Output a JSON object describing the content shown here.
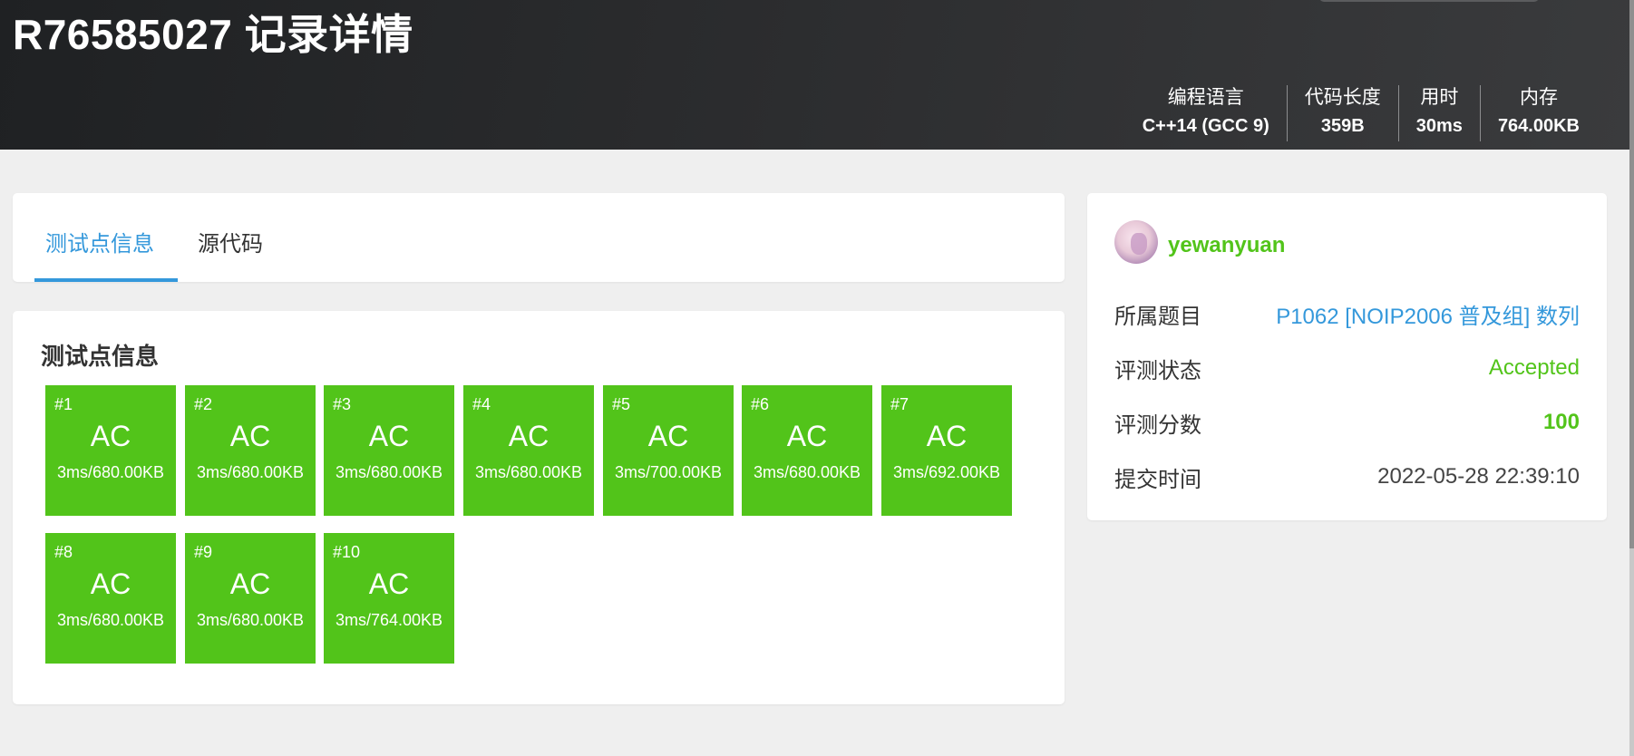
{
  "record": {
    "title": "R76585027 记录详情"
  },
  "stats": [
    {
      "label": "编程语言",
      "value": "C++14 (GCC 9)"
    },
    {
      "label": "代码长度",
      "value": "359B"
    },
    {
      "label": "用时",
      "value": "30ms"
    },
    {
      "label": "内存",
      "value": "764.00KB"
    }
  ],
  "tabs": [
    {
      "label": "测试点信息",
      "active": true
    },
    {
      "label": "源代码",
      "active": false
    }
  ],
  "testcases": {
    "title": "测试点信息",
    "color": "#52c41a",
    "items": [
      {
        "id": "#1",
        "status": "AC",
        "detail": "3ms/680.00KB"
      },
      {
        "id": "#2",
        "status": "AC",
        "detail": "3ms/680.00KB"
      },
      {
        "id": "#3",
        "status": "AC",
        "detail": "3ms/680.00KB"
      },
      {
        "id": "#4",
        "status": "AC",
        "detail": "3ms/680.00KB"
      },
      {
        "id": "#5",
        "status": "AC",
        "detail": "3ms/700.00KB"
      },
      {
        "id": "#6",
        "status": "AC",
        "detail": "3ms/680.00KB"
      },
      {
        "id": "#7",
        "status": "AC",
        "detail": "3ms/692.00KB"
      },
      {
        "id": "#8",
        "status": "AC",
        "detail": "3ms/680.00KB"
      },
      {
        "id": "#9",
        "status": "AC",
        "detail": "3ms/680.00KB"
      },
      {
        "id": "#10",
        "status": "AC",
        "detail": "3ms/764.00KB"
      }
    ]
  },
  "submission": {
    "username": "yewanyuan",
    "avatar_icon": "user-avatar-icon",
    "rows": [
      {
        "label": "所属题目",
        "value": "P1062 [NOIP2006 普及组] 数列"
      },
      {
        "label": "评测状态",
        "value": "Accepted"
      },
      {
        "label": "评测分数",
        "value": "100"
      },
      {
        "label": "提交时间",
        "value": "2022-05-28 22:39:10"
      }
    ]
  },
  "colors": {
    "accent": "#3498db",
    "accepted": "#52c41a",
    "header": "#2b2c2e"
  }
}
